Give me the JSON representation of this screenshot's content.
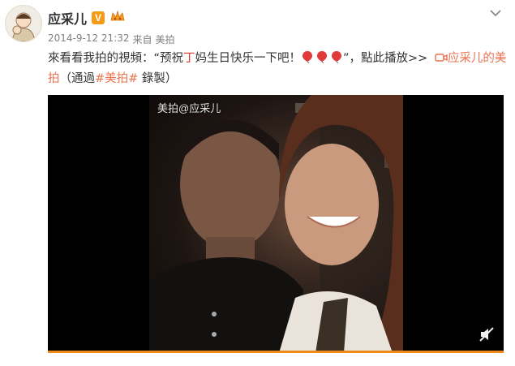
{
  "post": {
    "author": "应采儿",
    "verified_badge": "V",
    "time": "2014-9-12 21:32",
    "source_prefix": "来自",
    "source": "美拍",
    "text": {
      "p1": "來看看我拍的視頻：“预祝",
      "highlight": "丁",
      "p2": "妈生日快乐一下吧！",
      "p3": "”，點此播放>>",
      "link_icon": "video-camera-icon",
      "link_text": "应采儿的美拍",
      "p4": "（通過",
      "hashtag": "#美拍#",
      "p5": " 錄製）"
    },
    "video": {
      "watermark": "美拍@应采儿",
      "mute_icon": "mute-icon"
    }
  },
  "colors": {
    "accent": "#eb7350",
    "badge": "#f49b1a",
    "progress": "#f08a1c"
  }
}
